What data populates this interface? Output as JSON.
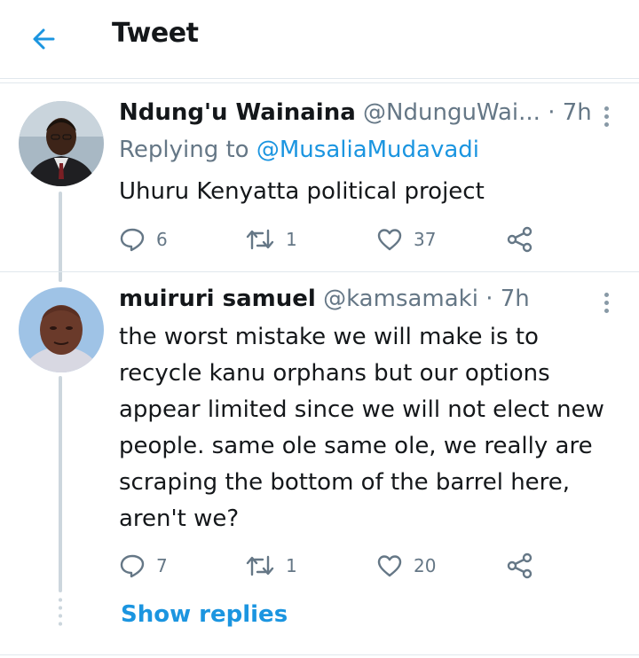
{
  "header": {
    "title": "Tweet",
    "back_icon": "arrow-left-icon",
    "accent": "#1b95e0"
  },
  "tweets": [
    {
      "name": "Ndung'u Wainaina",
      "handle": "@NdunguWai...",
      "time": "· 7h",
      "replying_prefix": "Replying to",
      "replying_to": "@MusaliaMudavadi",
      "text": "Uhuru Kenyatta political project",
      "replies": "6",
      "retweets": "1",
      "likes": "37"
    },
    {
      "name": "muiruri samuel",
      "handle": "@kamsamaki",
      "time": "· 7h",
      "text": "the worst mistake we will make is to recycle kanu orphans but our options appear limited since we will not elect new people. same ole same ole, we really are scraping the bottom of the barrel here, aren't we?",
      "replies": "7",
      "retweets": "1",
      "likes": "20"
    }
  ],
  "show_replies": "Show replies"
}
